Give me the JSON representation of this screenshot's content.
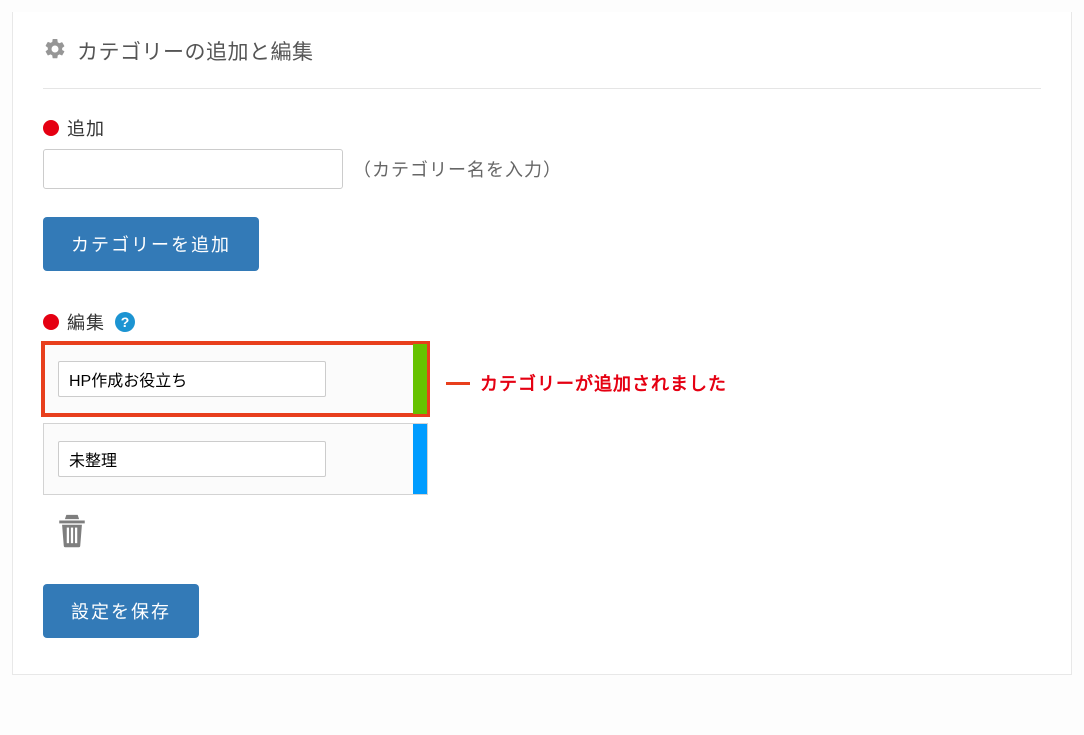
{
  "panel": {
    "title": "カテゴリーの追加と編集"
  },
  "add": {
    "section_label": "追加",
    "hint": "（カテゴリー名を入力）",
    "button_label": "カテゴリーを追加",
    "value": ""
  },
  "edit": {
    "section_label": "編集",
    "help_symbol": "?",
    "items": [
      {
        "value": "HP作成お役立ち",
        "color": "green",
        "highlighted": true
      },
      {
        "value": "未整理",
        "color": "blue",
        "highlighted": false
      }
    ]
  },
  "annotation": {
    "text": "カテゴリーが追加されました"
  },
  "save": {
    "button_label": "設定を保存"
  }
}
